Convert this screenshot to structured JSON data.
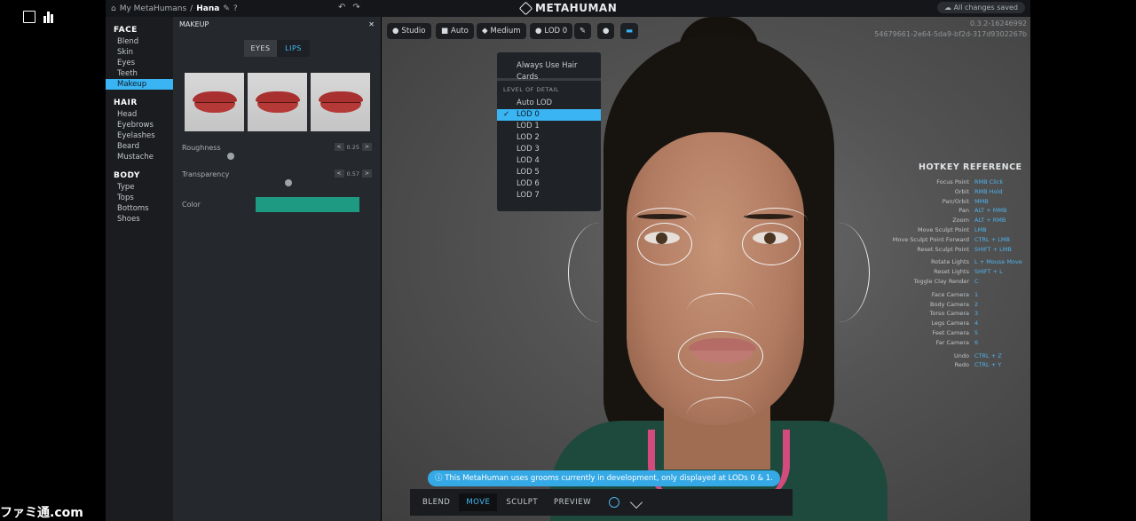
{
  "breadcrumb": {
    "parent": "My MetaHumans",
    "separator": "/",
    "current": "Hana"
  },
  "logo": {
    "text": "METAHUMAN"
  },
  "status": {
    "saved": "All changes saved"
  },
  "version": {
    "line1": "0.3.2-16246992",
    "line2": "54679661-2e64-5da9-bf2d-317d9302267b"
  },
  "nav": {
    "face": {
      "title": "FACE",
      "items": [
        "Blend",
        "Skin",
        "Eyes",
        "Teeth",
        "Makeup"
      ],
      "active": "Makeup"
    },
    "hair": {
      "title": "HAIR",
      "items": [
        "Head",
        "Eyebrows",
        "Eyelashes",
        "Beard",
        "Mustache"
      ]
    },
    "body": {
      "title": "BODY",
      "items": [
        "Type",
        "Tops",
        "Bottoms",
        "Shoes"
      ]
    }
  },
  "panel": {
    "title": "MAKEUP",
    "close": "✕",
    "tabs": [
      "EYES",
      "LIPS"
    ],
    "active_tab": "LIPS",
    "roughness": {
      "label": "Roughness",
      "value": "0.25"
    },
    "transparency": {
      "label": "Transparency",
      "value": "0.57"
    },
    "color": {
      "label": "Color",
      "value": "#1e9a82"
    }
  },
  "toolbar": {
    "studio": "Studio",
    "auto": "Auto",
    "medium": "Medium",
    "lod": "LOD 0"
  },
  "lod_menu": {
    "always_hair_cards": "Always Use Hair Cards",
    "caption": "LEVEL OF DETAIL",
    "options": [
      "Auto LOD",
      "LOD 0",
      "LOD 1",
      "LOD 2",
      "LOD 3",
      "LOD 4",
      "LOD 5",
      "LOD 6",
      "LOD 7"
    ],
    "selected": "LOD 0"
  },
  "hotkeys": {
    "title": "HOTKEY REFERENCE",
    "rows": [
      {
        "k": "Focus Point",
        "v": "RMB Click"
      },
      {
        "k": "Orbit",
        "v": "RMB Hold"
      },
      {
        "k": "Pan/Orbit",
        "v": "MMB"
      },
      {
        "k": "Pan",
        "v": "ALT + MMB"
      },
      {
        "k": "Zoom",
        "v": "ALT + RMB"
      },
      {
        "k": "Move Sculpt Point",
        "v": "LMB"
      },
      {
        "k": "Move Sculpt Point Forward",
        "v": "CTRL + LMB"
      },
      {
        "k": "Reset Sculpt Point",
        "v": "SHIFT + LMB"
      },
      {
        "k": "Rotate Lights",
        "v": "L + Mouse Move"
      },
      {
        "k": "Reset Lights",
        "v": "SHIFT + L"
      },
      {
        "k": "Toggle Clay Render",
        "v": "C"
      },
      {
        "k": "Face Camera",
        "v": "1"
      },
      {
        "k": "Body Camera",
        "v": "2"
      },
      {
        "k": "Torso Camera",
        "v": "3"
      },
      {
        "k": "Legs Camera",
        "v": "4"
      },
      {
        "k": "Feet Camera",
        "v": "5"
      },
      {
        "k": "Far Camera",
        "v": "6"
      },
      {
        "k": "Undo",
        "v": "CTRL + Z"
      },
      {
        "k": "Redo",
        "v": "CTRL + Y"
      }
    ]
  },
  "banner": "This MetaHuman uses grooms currently in development, only displayed at LODs 0 & 1.",
  "modes": {
    "items": [
      "BLEND",
      "MOVE",
      "SCULPT",
      "PREVIEW"
    ],
    "active": "MOVE"
  },
  "watermark": "ファミ通.com",
  "colors": {
    "accent": "#3ab4f2",
    "panel": "#25282c",
    "nav": "#1a1c1f"
  }
}
